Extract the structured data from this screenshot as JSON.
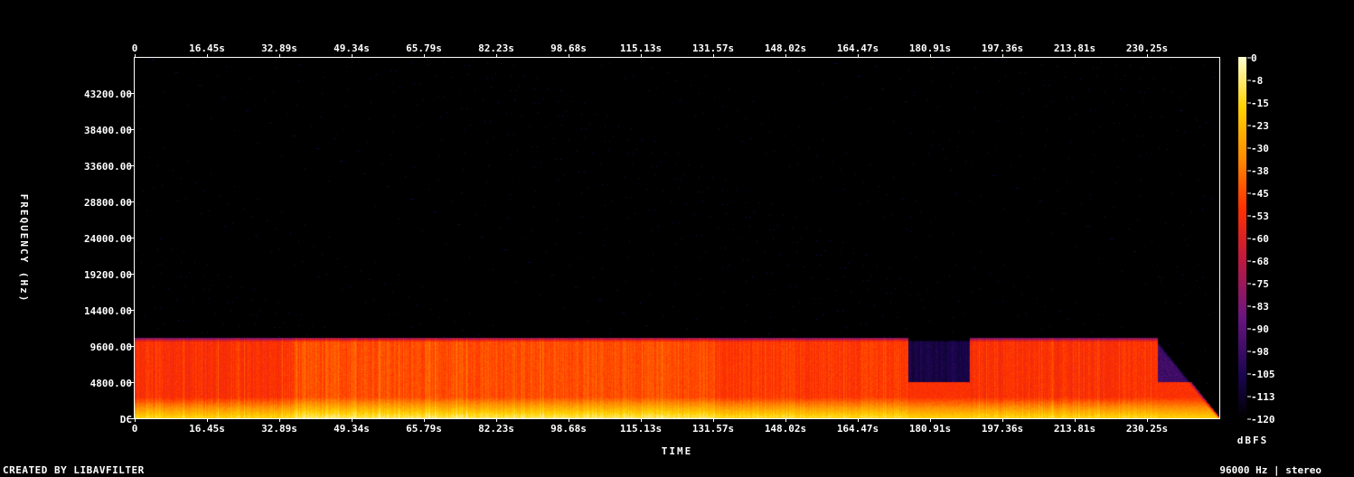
{
  "chart_data": {
    "type": "heatmap",
    "subtype": "spectrogram",
    "xlabel": "TIME",
    "ylabel": "FREQUENCY (Hz)",
    "colorbar_label": "dBFS",
    "x_ticks": [
      "0",
      "16.45s",
      "32.89s",
      "49.34s",
      "65.79s",
      "82.23s",
      "98.68s",
      "115.13s",
      "131.57s",
      "148.02s",
      "164.47s",
      "180.91s",
      "197.36s",
      "213.81s",
      "230.25s"
    ],
    "y_ticks": [
      "DC",
      "4800.00",
      "9600.00",
      "14400.00",
      "19200.00",
      "24000.00",
      "28800.00",
      "33600.00",
      "38400.00",
      "43200.00"
    ],
    "colorbar_ticks": [
      "0",
      "-8",
      "-15",
      "-23",
      "-30",
      "-38",
      "-45",
      "-53",
      "-60",
      "-68",
      "-75",
      "-83",
      "-90",
      "-98",
      "-105",
      "-113",
      "-120"
    ],
    "xlim": [
      0,
      247
    ],
    "ylim": [
      0,
      48000
    ],
    "zlim": [
      -120,
      0
    ],
    "colormap": [
      "#000000",
      "#1a0550",
      "#6a1580",
      "#c41a3a",
      "#ff3000",
      "#ff8c00",
      "#ffd200",
      "#ffffd0"
    ],
    "segments": [
      {
        "t0": 0,
        "t1": 36,
        "cutoff_hz": 10900,
        "mid_db": -52
      },
      {
        "t0": 36,
        "t1": 132,
        "cutoff_hz": 10900,
        "mid_db": -46
      },
      {
        "t0": 132,
        "t1": 176,
        "cutoff_hz": 10900,
        "mid_db": -50
      },
      {
        "t0": 176,
        "t1": 190,
        "cutoff_hz": 10900,
        "mid_db": -105
      },
      {
        "t0": 190,
        "t1": 233,
        "cutoff_hz": 10900,
        "mid_db": -52
      },
      {
        "t0": 233,
        "t1": 247,
        "cutoff_hz": 10200,
        "mid_db": -100
      }
    ]
  },
  "footer": {
    "created_by": "CREATED BY LIBAVFILTER",
    "info": "96000 Hz | stereo"
  }
}
